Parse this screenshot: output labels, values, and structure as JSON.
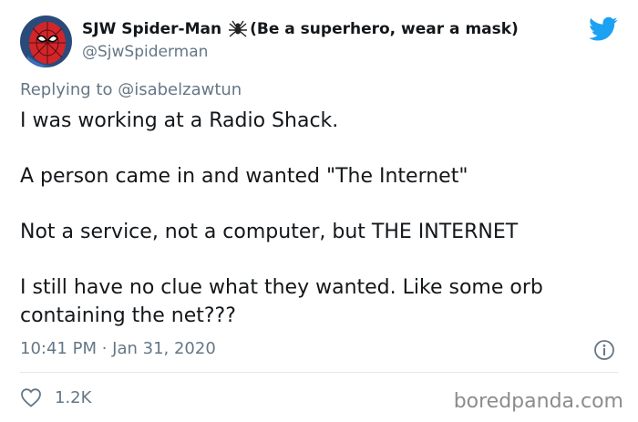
{
  "author": {
    "display_name": "SJW Spider-Man",
    "display_name_suffix": "(Be a superhero, wear a mask)",
    "handle": "@SjwSpiderman",
    "avatar_icon": "spiderman-avatar",
    "name_emoji": "spider-icon"
  },
  "reply": {
    "prefix": "Replying to",
    "mention": "@isabelzawtun"
  },
  "tweet": {
    "lines": [
      "I was working at a Radio Shack.",
      "A person came in and wanted \"The Internet\"",
      "Not a service, not a computer, but THE INTERNET",
      "I still have no clue what they wanted. Like some orb containing the net???"
    ]
  },
  "meta": {
    "timestamp": "10:41 PM · Jan 31, 2020"
  },
  "actions": {
    "like_count": "1.2K"
  },
  "watermark": "boredpanda.com",
  "colors": {
    "twitter_blue": "#1da1f2",
    "secondary_text": "#657786",
    "primary_text": "#14171a"
  }
}
